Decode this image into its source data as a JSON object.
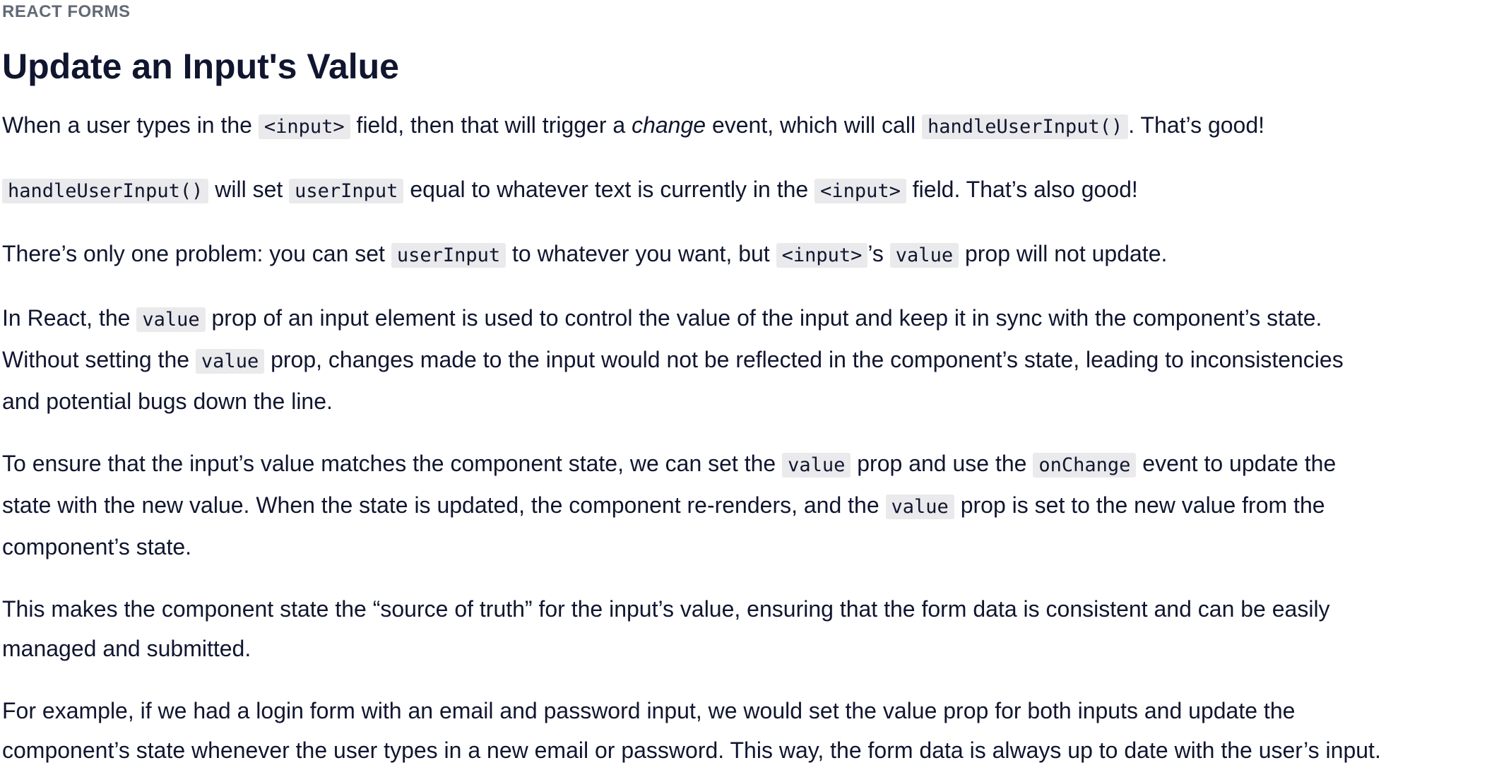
{
  "lesson": {
    "eyebrow": "REACT FORMS",
    "title": "Update an Input's Value"
  },
  "paragraphs": {
    "p1": {
      "t1": "When a user types in the ",
      "c1": "<input>",
      "t2": " field, then that will trigger a ",
      "em1": "change",
      "t3": " event, which will call ",
      "c2": "handleUserInput()",
      "t4": ". That’s good!"
    },
    "p2": {
      "c1": "handleUserInput()",
      "t1": " will set ",
      "c2": "userInput",
      "t2": " equal to whatever text is currently in the ",
      "c3": "<input>",
      "t3": " field. That’s also good!"
    },
    "p3": {
      "t1": "There’s only one problem: you can set ",
      "c1": "userInput",
      "t2": " to whatever you want, but ",
      "c2": "<input>",
      "t3": "’s ",
      "c3": "value",
      "t4": " prop will not update."
    },
    "p4": {
      "t1": "In React, the ",
      "c1": "value",
      "t2": " prop of an input element is used to control the value of the input and keep it in sync with the component’s state.",
      "t3": "Without setting the ",
      "c2": "value",
      "t4": " prop, changes made to the input would not be reflected in the component’s state, leading to inconsistencies",
      "t5": "and potential bugs down the line."
    },
    "p5": {
      "t1": "To ensure that the input’s value matches the component state, we can set the ",
      "c1": "value",
      "t2": " prop and use the ",
      "c2": "onChange",
      "t3": " event to update the",
      "t4": "state with the new value. When the state is updated, the component re-renders, and the ",
      "c3": "value",
      "t5": " prop is set to the new value from the",
      "t6": "component’s state."
    },
    "p6": {
      "t1": "This makes the component state the “source of truth” for the input’s value, ensuring that the form data is consistent and can be easily",
      "t2": "managed and submitted."
    },
    "p7": {
      "t1": "For example, if we had a login form with an email and password input, we would set the value prop for both inputs and update the",
      "t2": "component’s state whenever the user types in a new email or password. This way, the form data is always up to date with the user’s input."
    }
  }
}
